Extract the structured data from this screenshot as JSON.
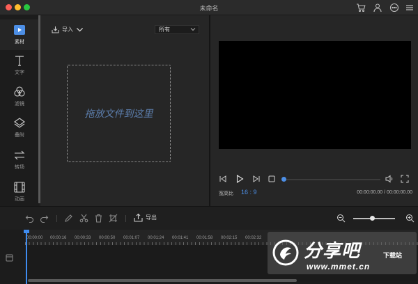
{
  "window": {
    "title": "未命名"
  },
  "sidebar": {
    "items": [
      {
        "label": "素材",
        "icon": "media-icon",
        "active": true
      },
      {
        "label": "文字",
        "icon": "text-icon",
        "active": false
      },
      {
        "label": "滤镜",
        "icon": "filter-icon",
        "active": false
      },
      {
        "label": "叠附",
        "icon": "overlay-icon",
        "active": false
      },
      {
        "label": "转场",
        "icon": "transition-icon",
        "active": false
      },
      {
        "label": "动画",
        "icon": "animation-icon",
        "active": false
      }
    ]
  },
  "media": {
    "import_label": "导入",
    "filter_value": "所有",
    "drop_hint": "拖放文件到这里"
  },
  "preview": {
    "aspect_label": "宽高比",
    "aspect_value": "16 : 9",
    "time_readout": "00:00:00.00 / 00:00:00.00",
    "progress": 0
  },
  "timeline": {
    "export_label": "导出",
    "zoom_level": 0.45,
    "ruler_labels": [
      "00:00:00",
      "00:00:16",
      "00:00:33",
      "00:00:50",
      "00:01:07",
      "00:01:24",
      "00:01:41",
      "00:01:58",
      "00:02:15",
      "00:02:32"
    ]
  },
  "watermark": {
    "brand": "分享吧",
    "sub": "下载站",
    "url": "www.mmet.cn"
  },
  "colors": {
    "accent": "#4d8fe6",
    "playhead": "#3f8cf0",
    "background": "#1f1f1f",
    "panel": "#262626"
  }
}
